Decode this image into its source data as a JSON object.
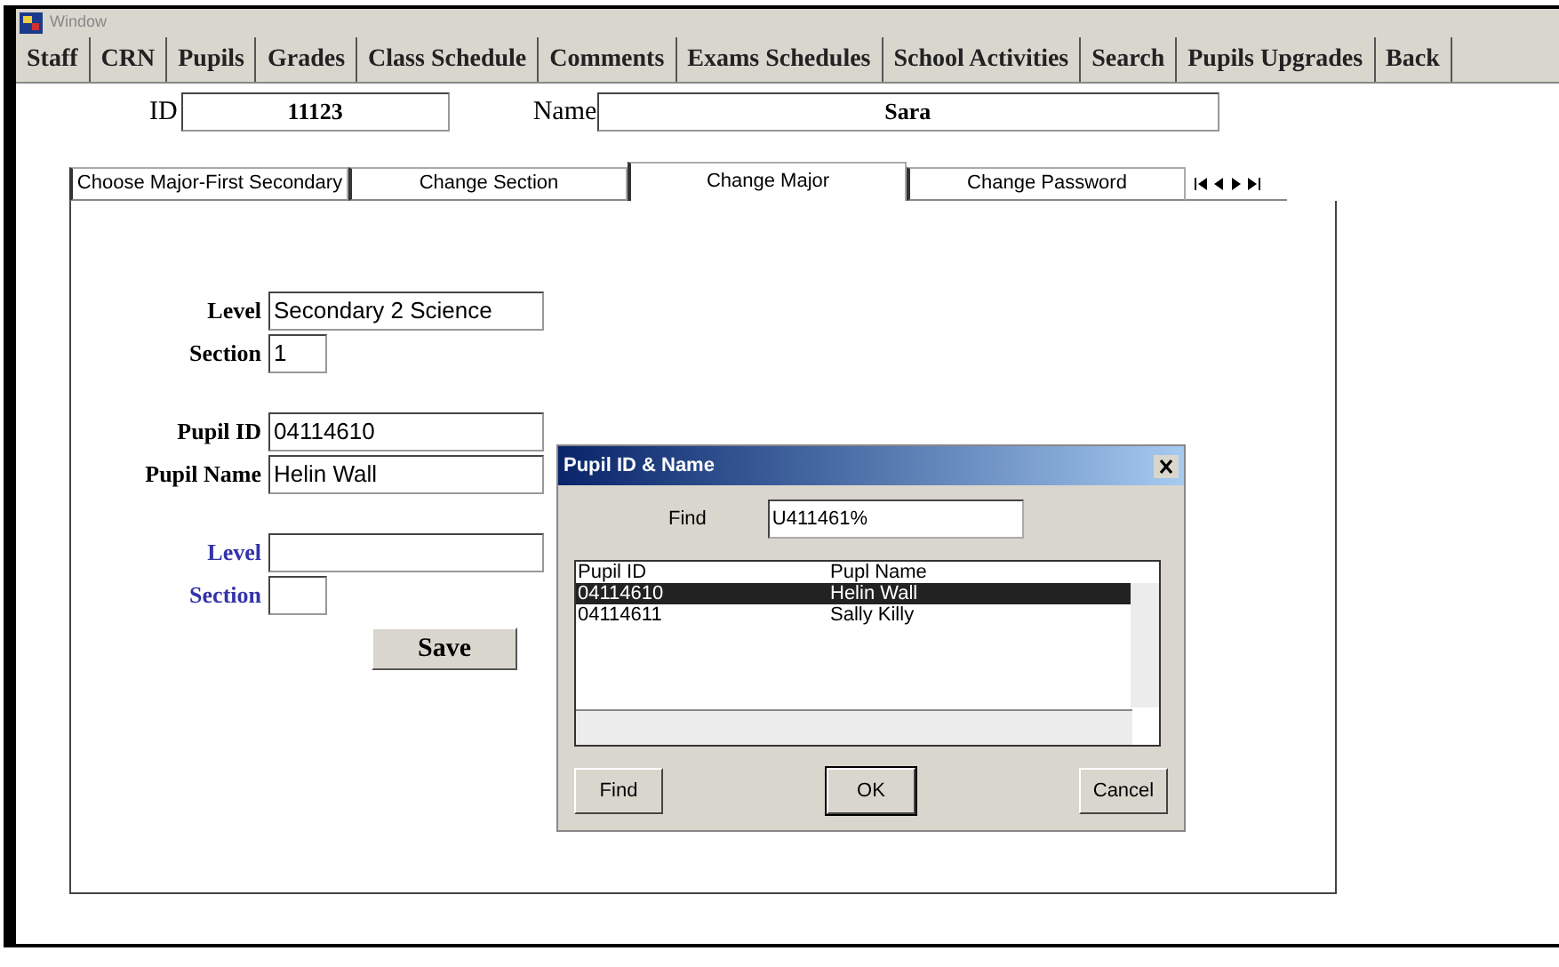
{
  "window": {
    "title": "Window"
  },
  "menu": [
    {
      "label": "Staff"
    },
    {
      "label": "CRN"
    },
    {
      "label": "Pupils"
    },
    {
      "label": "Grades"
    },
    {
      "label": "Class Schedule"
    },
    {
      "label": "Comments"
    },
    {
      "label": "Exams Schedules"
    },
    {
      "label": "School Activities"
    },
    {
      "label": "Search"
    },
    {
      "label": "Pupils Upgrades"
    },
    {
      "label": "Back"
    }
  ],
  "header": {
    "id_label": "ID",
    "id_value": "11123",
    "name_label": "Name",
    "name_value": "Sara"
  },
  "tabs": [
    {
      "label": "Choose Major-First Secondary",
      "selected": false
    },
    {
      "label": "Change Section",
      "selected": false
    },
    {
      "label": "Change Major",
      "selected": true
    },
    {
      "label": "Change Password",
      "selected": false
    }
  ],
  "form": {
    "current_major": [
      {
        "label": "Level",
        "value": "Secondary 2 Science",
        "kind": "wide"
      },
      {
        "label": "Section",
        "value": "1",
        "kind": "narrow"
      }
    ],
    "pupil": [
      {
        "label": "Pupil ID",
        "value": "04114610",
        "kind": "wide"
      },
      {
        "label": "Pupil Name",
        "value": "Helin Wall",
        "kind": "wide"
      }
    ],
    "new_major": [
      {
        "label": "Level",
        "kind": "wide"
      },
      {
        "label": "Section",
        "kind": "narrow"
      }
    ]
  },
  "save_button": "Save",
  "dialog": {
    "title": "Pupil ID & Name",
    "find_label": "Find",
    "find_value": "U411461%",
    "columns": [
      "Pupil ID",
      "Pupl Name"
    ],
    "rows": [
      {
        "cells": [
          "04114610",
          "Helin Wall"
        ],
        "selected": true
      },
      {
        "cells": [
          "04114611",
          "Sally Killy"
        ],
        "selected": false
      }
    ],
    "buttons": [
      "Find",
      "OK",
      "Cancel"
    ]
  }
}
